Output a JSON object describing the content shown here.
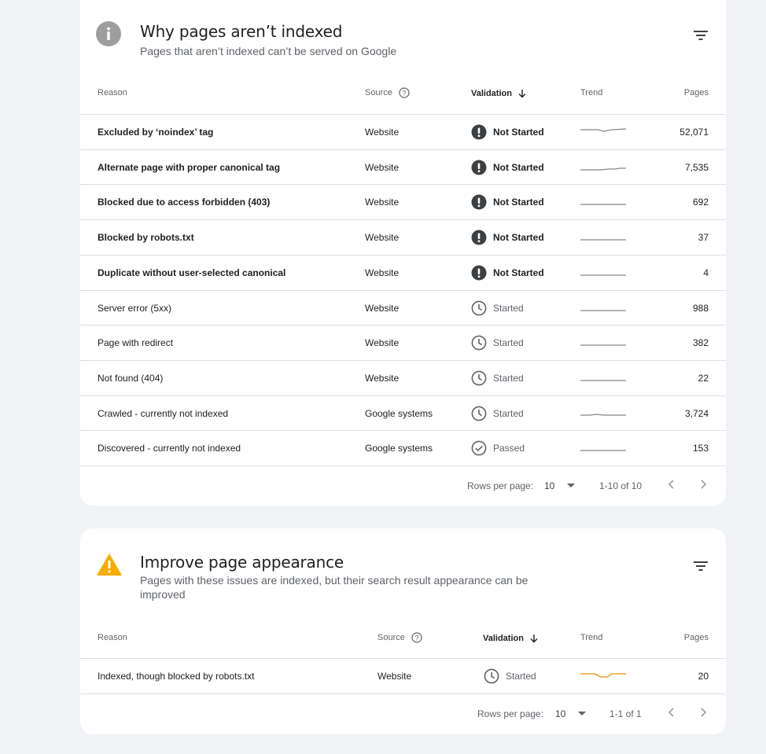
{
  "colors": {
    "accent_dark": "#3c4043",
    "muted": "#5f6368",
    "warning": "#f9ab00",
    "trend_grey": "#80868b",
    "trend_orange": "#e8910c"
  },
  "card1": {
    "title": "Why pages aren’t indexed",
    "subtitle": "Pages that aren’t indexed can’t be served on Google",
    "head_icon": "info-icon",
    "columns": {
      "reason": "Reason",
      "source": "Source",
      "validation": "Validation",
      "trend": "Trend",
      "pages": "Pages"
    },
    "rows": [
      {
        "reason": "Excluded by ‘noindex’ tag",
        "source": "Website",
        "validation": "Not Started",
        "pages": "52,071"
      },
      {
        "reason": "Alternate page with proper canonical tag",
        "source": "Website",
        "validation": "Not Started",
        "pages": "7,535"
      },
      {
        "reason": "Blocked due to access forbidden (403)",
        "source": "Website",
        "validation": "Not Started",
        "pages": "692"
      },
      {
        "reason": "Blocked by robots.txt",
        "source": "Website",
        "validation": "Not Started",
        "pages": "37"
      },
      {
        "reason": "Duplicate without user-selected canonical",
        "source": "Website",
        "validation": "Not Started",
        "pages": "4"
      },
      {
        "reason": "Server error (5xx)",
        "source": "Website",
        "validation": "Started",
        "pages": "988"
      },
      {
        "reason": "Page with redirect",
        "source": "Website",
        "validation": "Started",
        "pages": "382"
      },
      {
        "reason": "Not found (404)",
        "source": "Website",
        "validation": "Started",
        "pages": "22"
      },
      {
        "reason": "Crawled - currently not indexed",
        "source": "Google systems",
        "validation": "Started",
        "pages": "3,724"
      },
      {
        "reason": "Discovered - currently not indexed",
        "source": "Google systems",
        "validation": "Passed",
        "pages": "153"
      }
    ],
    "pagination": {
      "rows_label": "Rows per page:",
      "rows_value": "10",
      "range": "1-10 of 10"
    }
  },
  "card2": {
    "title": "Improve page appearance",
    "subtitle_line1": "Pages with these issues are indexed, but their search result appearance can be",
    "subtitle_line2": "improved",
    "head_icon": "warning-icon",
    "columns": {
      "reason": "Reason",
      "source": "Source",
      "validation": "Validation",
      "trend": "Trend",
      "pages": "Pages"
    },
    "rows": [
      {
        "reason": "Indexed, though blocked by robots.txt",
        "source": "Website",
        "validation": "Started",
        "pages": "20"
      }
    ],
    "pagination": {
      "rows_label": "Rows per page:",
      "rows_value": "10",
      "range": "1-1 of 1"
    }
  }
}
